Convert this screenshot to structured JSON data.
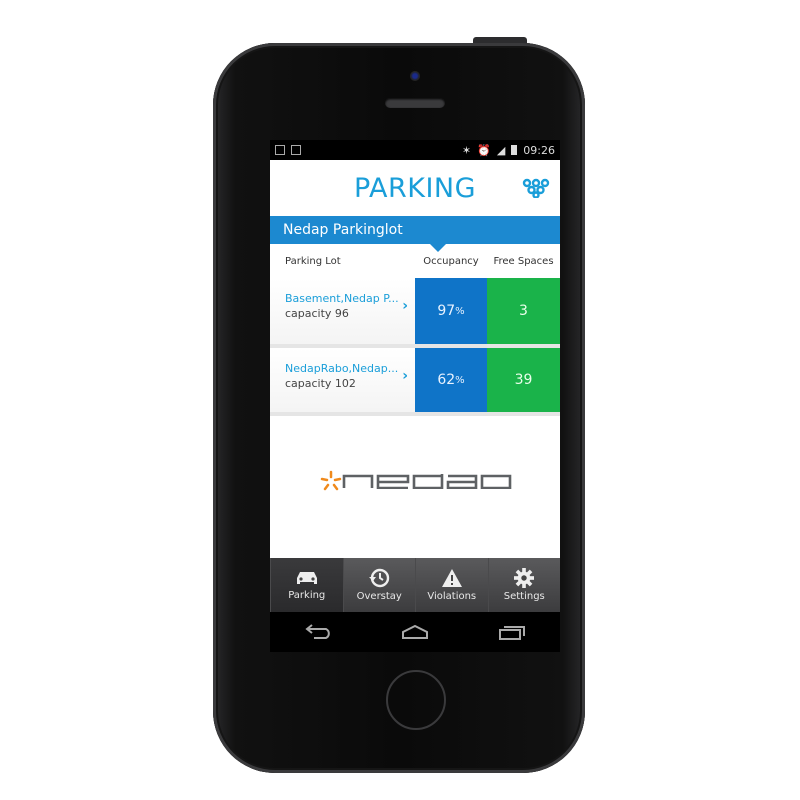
{
  "statusbar": {
    "time": "09:26"
  },
  "header": {
    "title": "PARKING",
    "logo_icon": "nedap-rings-icon"
  },
  "lot": {
    "name": "Nedap Parkinglot"
  },
  "columns": {
    "lot": "Parking Lot",
    "occupancy": "Occupancy",
    "free": "Free Spaces"
  },
  "rows": [
    {
      "name": "Basement,Nedap P...",
      "capacity": "capacity 96",
      "occupancy": "97",
      "free": "3"
    },
    {
      "name": "NedapRabo,Nedap...",
      "capacity": "capacity 102",
      "occupancy": "62",
      "free": "39"
    }
  ],
  "units": {
    "percent": "%"
  },
  "brand": {
    "name": "nedap"
  },
  "tabs": [
    {
      "label": "Parking",
      "icon": "car-icon",
      "active": true
    },
    {
      "label": "Overstay",
      "icon": "history-icon",
      "active": false
    },
    {
      "label": "Violations",
      "icon": "warning-icon",
      "active": false
    },
    {
      "label": "Settings",
      "icon": "gear-icon",
      "active": false
    }
  ],
  "colors": {
    "accent": "#1a9ed9",
    "lotbar": "#1c89d0",
    "occupancy": "#0f74c8",
    "free": "#1ab34a"
  }
}
